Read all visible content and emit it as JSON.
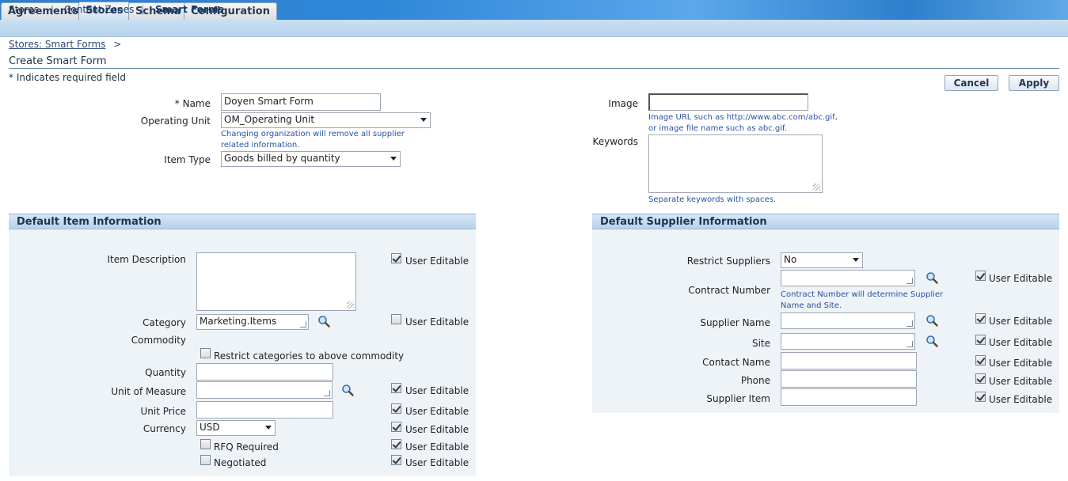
{
  "tabs": [
    "Agreements",
    "Stores",
    "Schema",
    "Configuration"
  ],
  "subnav": [
    "Stores",
    "Content Zones",
    "Smart Forms"
  ],
  "breadcrumb": {
    "link": "Stores: Smart Forms",
    "separator": ">"
  },
  "page_title": "Create Smart Form",
  "required_hint": "* Indicates required field",
  "buttons": {
    "cancel": "Cancel",
    "apply": "Apply"
  },
  "form": {
    "name_label": "* Name",
    "name_value": "Doyen Smart Form",
    "operating_unit_label": "Operating Unit",
    "operating_unit_value": "OM_Operating Unit",
    "operating_unit_note": "Changing organization will remove all supplier related information.",
    "item_type_label": "Item Type",
    "item_type_value": "Goods billed by quantity",
    "image_label": "Image",
    "image_note": "Image URL such as http://www.abc.com/abc.gif, or image file name such as abc.gif.",
    "keywords_label": "Keywords",
    "keywords_note": "Separate keywords with spaces."
  },
  "item_section": {
    "title": "Default Item Information",
    "item_description_label": "Item Description",
    "category_label": "Category",
    "category_value": "Marketing.Items",
    "commodity_label": "Commodity",
    "restrict_categories_label": "Restrict categories to above commodity",
    "quantity_label": "Quantity",
    "uom_label": "Unit of Measure",
    "unit_price_label": "Unit Price",
    "currency_label": "Currency",
    "currency_value": "USD",
    "rfq_label": "RFQ Required",
    "negotiated_label": "Negotiated",
    "user_editable_label": "User Editable"
  },
  "supplier_section": {
    "title": "Default Supplier Information",
    "restrict_suppliers_label": "Restrict Suppliers",
    "restrict_suppliers_value": "No",
    "contract_number_label": "Contract Number",
    "contract_note": "Contract Number will determine Supplier Name and Site.",
    "supplier_name_label": "Supplier Name",
    "site_label": "Site",
    "contact_name_label": "Contact Name",
    "phone_label": "Phone",
    "supplier_item_label": "Supplier Item",
    "user_editable_label": "User Editable"
  },
  "colors": {
    "topbar": "#2f86d8",
    "subnav": "#c3daf0",
    "section_header": "#c7dcef",
    "section_body": "#eef3f8",
    "note_text": "#2952a3"
  }
}
